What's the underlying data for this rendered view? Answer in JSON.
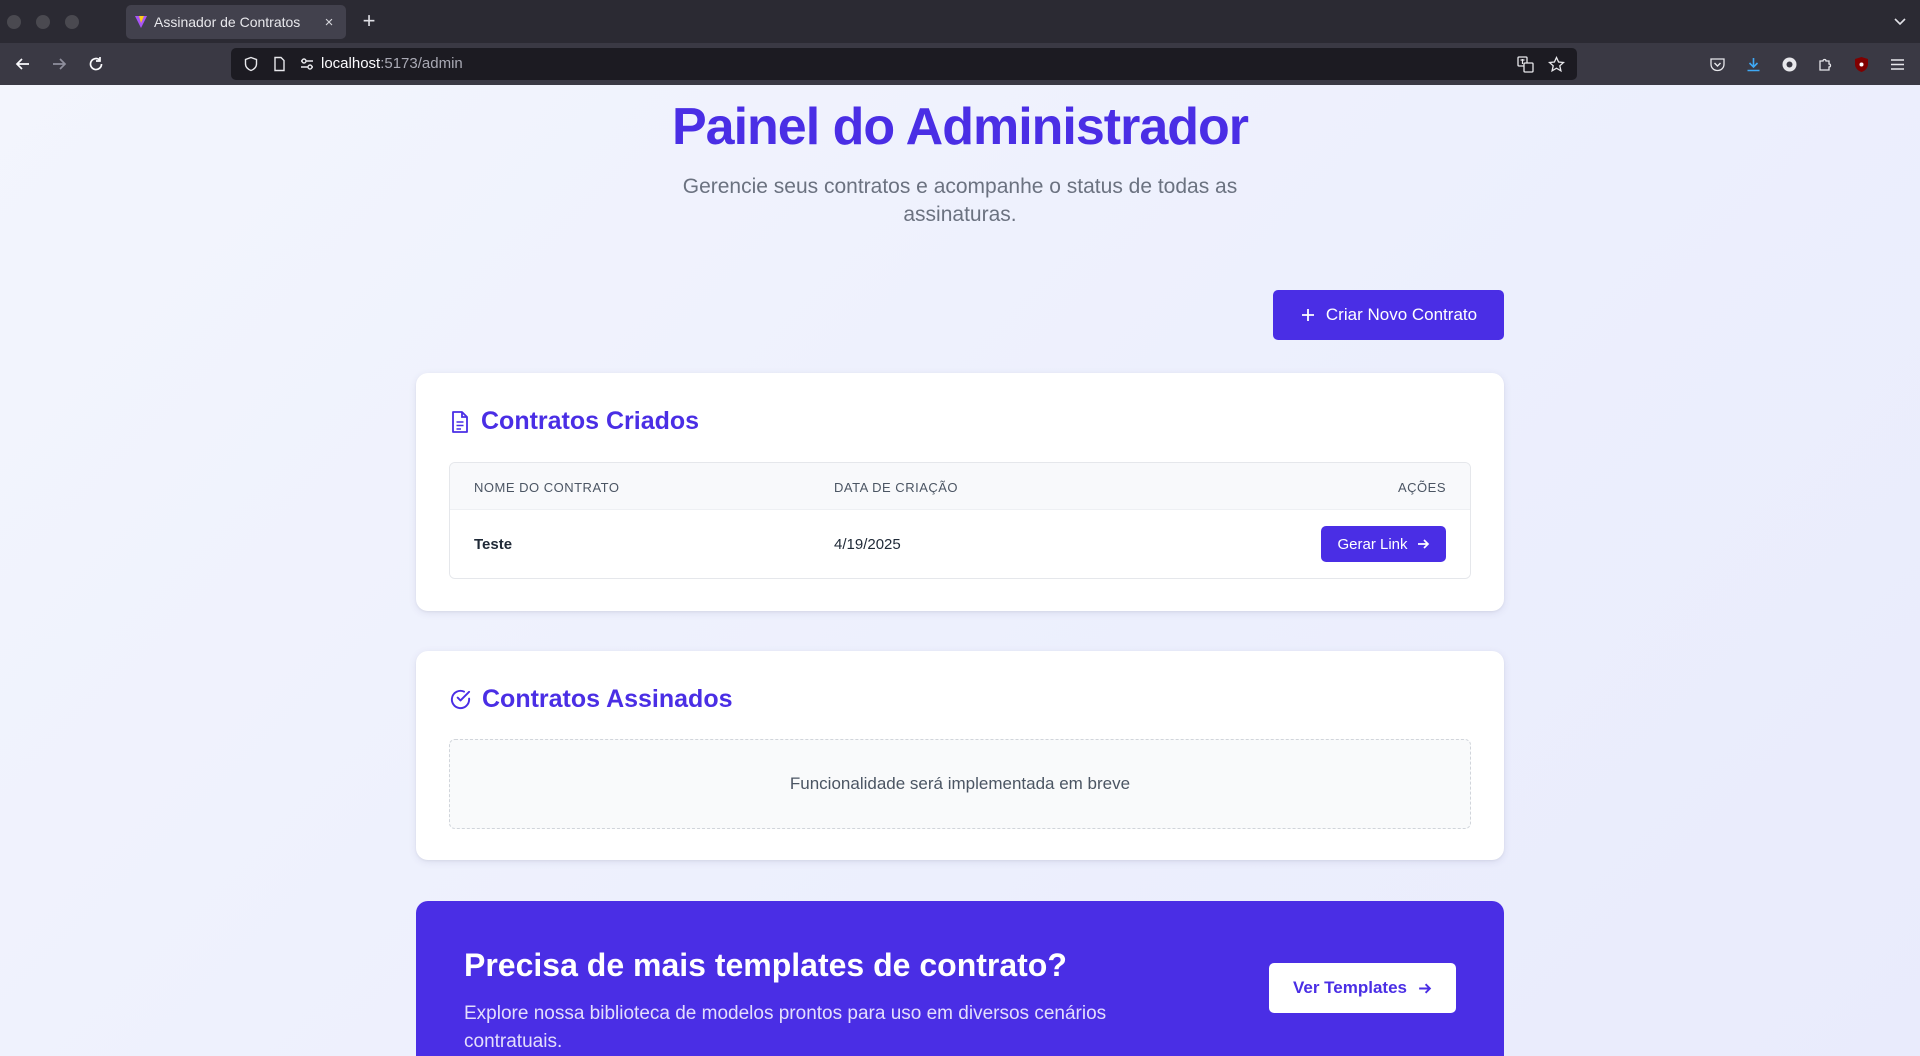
{
  "browser": {
    "tab_title": "Assinador de Contratos",
    "tab_close": "×",
    "new_tab": "+",
    "url_host": "localhost",
    "url_rest": ":5173/admin"
  },
  "page": {
    "title": "Painel do Administrador",
    "subtitle": "Gerencie seus contratos e acompanhe o status de todas as assinaturas.",
    "create_button": "Criar Novo Contrato"
  },
  "created_contracts": {
    "title": "Contratos Criados",
    "columns": [
      "Nome do Contrato",
      "Data de Criação",
      "Ações"
    ],
    "rows": [
      {
        "name": "Teste",
        "date": "4/19/2025",
        "action": "Gerar Link"
      }
    ]
  },
  "signed_contracts": {
    "title": "Contratos Assinados",
    "empty_message": "Funcionalidade será implementada em breve"
  },
  "cta": {
    "title": "Precisa de mais templates de contrato?",
    "text": "Explore nossa biblioteca de modelos prontos para uso em diversos cenários contratuais.",
    "button": "Ver Templates"
  },
  "colors": {
    "accent": "#4a2ee5",
    "browser_bg": "#2b2a33"
  }
}
